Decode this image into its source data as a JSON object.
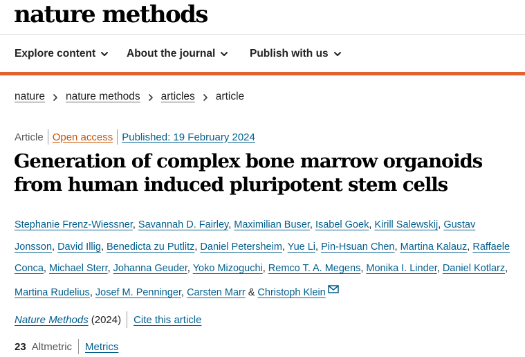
{
  "header": {
    "logo": "nature methods"
  },
  "nav": {
    "items": [
      {
        "label": "Explore content"
      },
      {
        "label": "About the journal"
      },
      {
        "label": "Publish with us"
      }
    ]
  },
  "breadcrumb": {
    "items": [
      "nature",
      "nature methods",
      "articles"
    ],
    "current": "article"
  },
  "article": {
    "type": "Article",
    "access": "Open access",
    "published": "Published: 19 February 2024",
    "title": "Generation of complex bone marrow organoids from human induced pluripotent stem cells",
    "authors": [
      "Stephanie Frenz-Wiessner",
      "Savannah D. Fairley",
      "Maximilian Buser",
      "Isabel Goek",
      "Kirill Salewskij",
      "Gustav Jonsson",
      "David Illig",
      "Benedicta zu Putlitz",
      "Daniel Petersheim",
      "Yue Li",
      "Pin-Hsuan Chen",
      "Martina Kalauz",
      "Raffaele Conca",
      "Michael Sterr",
      "Johanna Geuder",
      "Yoko Mizoguchi",
      "Remco T. A. Megens",
      "Monika I. Linder",
      "Daniel Kotlarz",
      "Martina Rudelius",
      "Josef M. Penninger",
      "Carsten Marr",
      "Christoph Klein"
    ],
    "corresponding_icon": "envelope-icon",
    "journal": "Nature Methods",
    "year": "(2024)",
    "cite_label": "Cite this article",
    "altmetric_score": "23",
    "altmetric_label": "Altmetric",
    "metrics_label": "Metrics"
  },
  "colors": {
    "accent_bar": "#e3612d",
    "link": "#025e8d",
    "open_access": "#c65301"
  }
}
